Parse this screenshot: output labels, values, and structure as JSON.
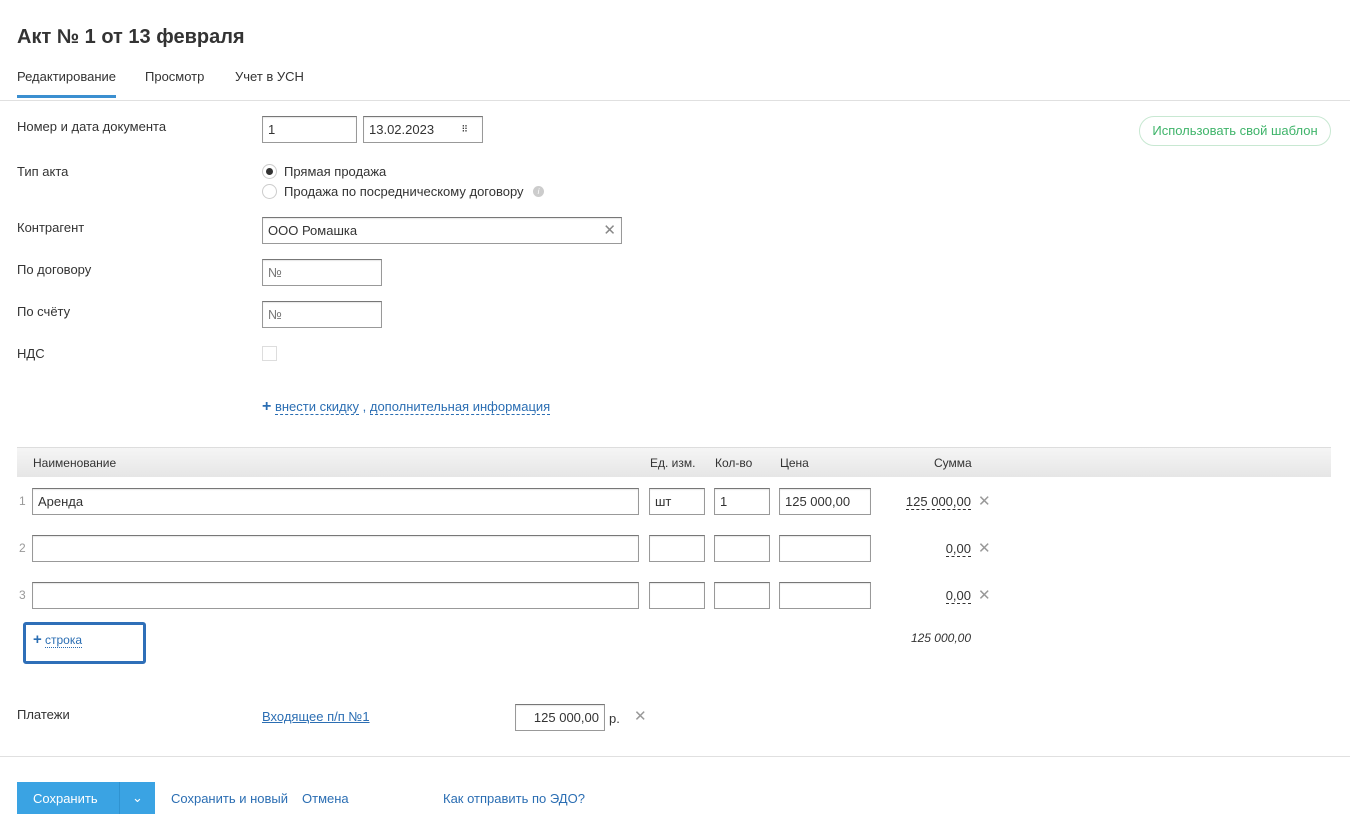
{
  "title": "Акт № 1 от 13 февраля",
  "tabs": [
    "Редактирование",
    "Просмотр",
    "Учет в УСН"
  ],
  "form": {
    "number_date_label": "Номер и дата документа",
    "number": "1",
    "date": "13.02.2023",
    "template_button": "Использовать свой шаблон",
    "type_label": "Тип акта",
    "type_options": [
      "Прямая продажа",
      "Продажа по посредническому договору"
    ],
    "counterparty_label": "Контрагент",
    "counterparty": "ООО Ромашка",
    "contract_label": "По договору",
    "contract_placeholder": "№",
    "invoice_label": "По счёту",
    "invoice_placeholder": "№",
    "vat_label": "НДС",
    "discount_link": "внести скидку",
    "sep": ",",
    "extra_link": "дополнительная информация"
  },
  "table": {
    "headers": [
      "Наименование",
      "Ед. изм.",
      "Кол-во",
      "Цена",
      "Сумма"
    ],
    "rows": [
      {
        "num": "1",
        "name": "Аренда",
        "unit": "шт",
        "qty": "1",
        "price": "125 000,00",
        "sum": "125 000,00"
      },
      {
        "num": "2",
        "name": "",
        "unit": "",
        "qty": "",
        "price": "",
        "sum": "0,00"
      },
      {
        "num": "3",
        "name": "",
        "unit": "",
        "qty": "",
        "price": "",
        "sum": "0,00"
      }
    ],
    "add_row": "строка",
    "total": "125 000,00"
  },
  "payments": {
    "label": "Платежи",
    "link": "Входящее п/п №1",
    "amount": "125 000,00",
    "currency": "р."
  },
  "footer": {
    "save": "Сохранить",
    "save_new": "Сохранить и новый",
    "cancel": "Отмена",
    "edo": "Как отправить по ЭДО?"
  }
}
